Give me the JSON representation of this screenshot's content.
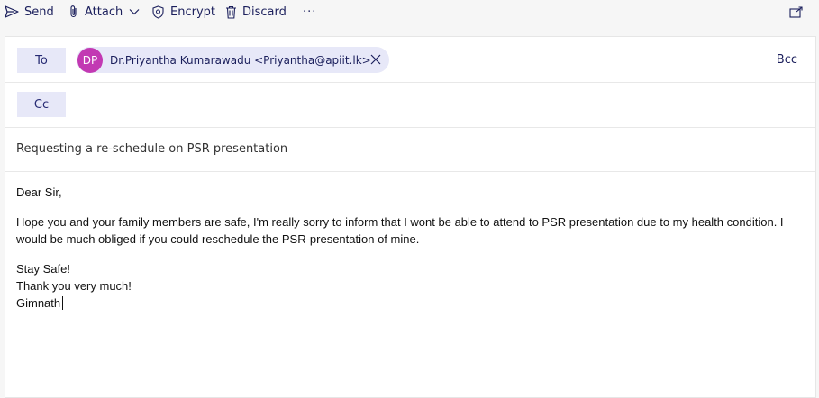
{
  "toolbar": {
    "send": "Send",
    "attach": "Attach",
    "encrypt": "Encrypt",
    "discard": "Discard",
    "more": "···"
  },
  "to": {
    "label": "To",
    "recipient": {
      "initials": "DP",
      "display": "Dr.Priyantha Kumarawadu <Priyantha@apiit.lk>",
      "avatar_color": "#c239b3"
    },
    "bcc_label": "Bcc"
  },
  "cc": {
    "label": "Cc"
  },
  "subject": "Requesting a re-schedule on PSR presentation",
  "body": {
    "greeting": "Dear Sir,",
    "paragraph": "Hope you and your family members are safe, I'm really sorry to inform that I wont be able to attend to PSR presentation due to my health condition. I would be much obliged if you could reschedule the PSR-presentation of mine.",
    "closing1": "Stay Safe!",
    "closing2": "Thank you very much!",
    "signature": "Gimnath"
  },
  "colors": {
    "accent": "#1b1f5c",
    "pill_bg": "#e7e8f8",
    "avatar": "#c239b3"
  },
  "icons": [
    "send-icon",
    "attach-icon",
    "chevron-down-icon",
    "encrypt-icon",
    "trash-icon",
    "more-icon",
    "popout-icon",
    "close-icon"
  ]
}
